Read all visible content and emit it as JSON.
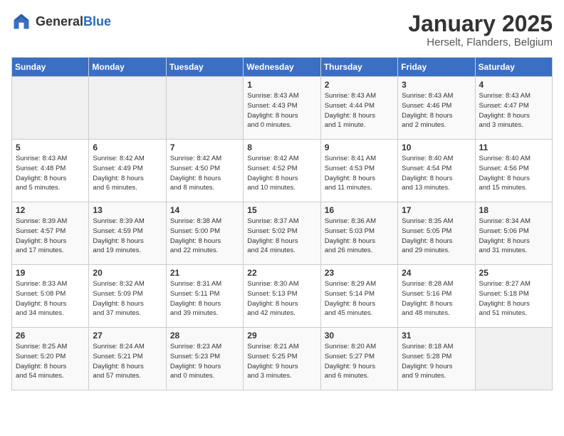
{
  "logo": {
    "text_general": "General",
    "text_blue": "Blue"
  },
  "title": {
    "month": "January 2025",
    "location": "Herselt, Flanders, Belgium"
  },
  "headers": [
    "Sunday",
    "Monday",
    "Tuesday",
    "Wednesday",
    "Thursday",
    "Friday",
    "Saturday"
  ],
  "weeks": [
    [
      {
        "day": "",
        "info": ""
      },
      {
        "day": "",
        "info": ""
      },
      {
        "day": "",
        "info": ""
      },
      {
        "day": "1",
        "info": "Sunrise: 8:43 AM\nSunset: 4:43 PM\nDaylight: 8 hours\nand 0 minutes."
      },
      {
        "day": "2",
        "info": "Sunrise: 8:43 AM\nSunset: 4:44 PM\nDaylight: 8 hours\nand 1 minute."
      },
      {
        "day": "3",
        "info": "Sunrise: 8:43 AM\nSunset: 4:46 PM\nDaylight: 8 hours\nand 2 minutes."
      },
      {
        "day": "4",
        "info": "Sunrise: 8:43 AM\nSunset: 4:47 PM\nDaylight: 8 hours\nand 3 minutes."
      }
    ],
    [
      {
        "day": "5",
        "info": "Sunrise: 8:43 AM\nSunset: 4:48 PM\nDaylight: 8 hours\nand 5 minutes."
      },
      {
        "day": "6",
        "info": "Sunrise: 8:42 AM\nSunset: 4:49 PM\nDaylight: 8 hours\nand 6 minutes."
      },
      {
        "day": "7",
        "info": "Sunrise: 8:42 AM\nSunset: 4:50 PM\nDaylight: 8 hours\nand 8 minutes."
      },
      {
        "day": "8",
        "info": "Sunrise: 8:42 AM\nSunset: 4:52 PM\nDaylight: 8 hours\nand 10 minutes."
      },
      {
        "day": "9",
        "info": "Sunrise: 8:41 AM\nSunset: 4:53 PM\nDaylight: 8 hours\nand 11 minutes."
      },
      {
        "day": "10",
        "info": "Sunrise: 8:40 AM\nSunset: 4:54 PM\nDaylight: 8 hours\nand 13 minutes."
      },
      {
        "day": "11",
        "info": "Sunrise: 8:40 AM\nSunset: 4:56 PM\nDaylight: 8 hours\nand 15 minutes."
      }
    ],
    [
      {
        "day": "12",
        "info": "Sunrise: 8:39 AM\nSunset: 4:57 PM\nDaylight: 8 hours\nand 17 minutes."
      },
      {
        "day": "13",
        "info": "Sunrise: 8:39 AM\nSunset: 4:59 PM\nDaylight: 8 hours\nand 19 minutes."
      },
      {
        "day": "14",
        "info": "Sunrise: 8:38 AM\nSunset: 5:00 PM\nDaylight: 8 hours\nand 22 minutes."
      },
      {
        "day": "15",
        "info": "Sunrise: 8:37 AM\nSunset: 5:02 PM\nDaylight: 8 hours\nand 24 minutes."
      },
      {
        "day": "16",
        "info": "Sunrise: 8:36 AM\nSunset: 5:03 PM\nDaylight: 8 hours\nand 26 minutes."
      },
      {
        "day": "17",
        "info": "Sunrise: 8:35 AM\nSunset: 5:05 PM\nDaylight: 8 hours\nand 29 minutes."
      },
      {
        "day": "18",
        "info": "Sunrise: 8:34 AM\nSunset: 5:06 PM\nDaylight: 8 hours\nand 31 minutes."
      }
    ],
    [
      {
        "day": "19",
        "info": "Sunrise: 8:33 AM\nSunset: 5:08 PM\nDaylight: 8 hours\nand 34 minutes."
      },
      {
        "day": "20",
        "info": "Sunrise: 8:32 AM\nSunset: 5:09 PM\nDaylight: 8 hours\nand 37 minutes."
      },
      {
        "day": "21",
        "info": "Sunrise: 8:31 AM\nSunset: 5:11 PM\nDaylight: 8 hours\nand 39 minutes."
      },
      {
        "day": "22",
        "info": "Sunrise: 8:30 AM\nSunset: 5:13 PM\nDaylight: 8 hours\nand 42 minutes."
      },
      {
        "day": "23",
        "info": "Sunrise: 8:29 AM\nSunset: 5:14 PM\nDaylight: 8 hours\nand 45 minutes."
      },
      {
        "day": "24",
        "info": "Sunrise: 8:28 AM\nSunset: 5:16 PM\nDaylight: 8 hours\nand 48 minutes."
      },
      {
        "day": "25",
        "info": "Sunrise: 8:27 AM\nSunset: 5:18 PM\nDaylight: 8 hours\nand 51 minutes."
      }
    ],
    [
      {
        "day": "26",
        "info": "Sunrise: 8:25 AM\nSunset: 5:20 PM\nDaylight: 8 hours\nand 54 minutes."
      },
      {
        "day": "27",
        "info": "Sunrise: 8:24 AM\nSunset: 5:21 PM\nDaylight: 8 hours\nand 57 minutes."
      },
      {
        "day": "28",
        "info": "Sunrise: 8:23 AM\nSunset: 5:23 PM\nDaylight: 9 hours\nand 0 minutes."
      },
      {
        "day": "29",
        "info": "Sunrise: 8:21 AM\nSunset: 5:25 PM\nDaylight: 9 hours\nand 3 minutes."
      },
      {
        "day": "30",
        "info": "Sunrise: 8:20 AM\nSunset: 5:27 PM\nDaylight: 9 hours\nand 6 minutes."
      },
      {
        "day": "31",
        "info": "Sunrise: 8:18 AM\nSunset: 5:28 PM\nDaylight: 9 hours\nand 9 minutes."
      },
      {
        "day": "",
        "info": ""
      }
    ]
  ]
}
